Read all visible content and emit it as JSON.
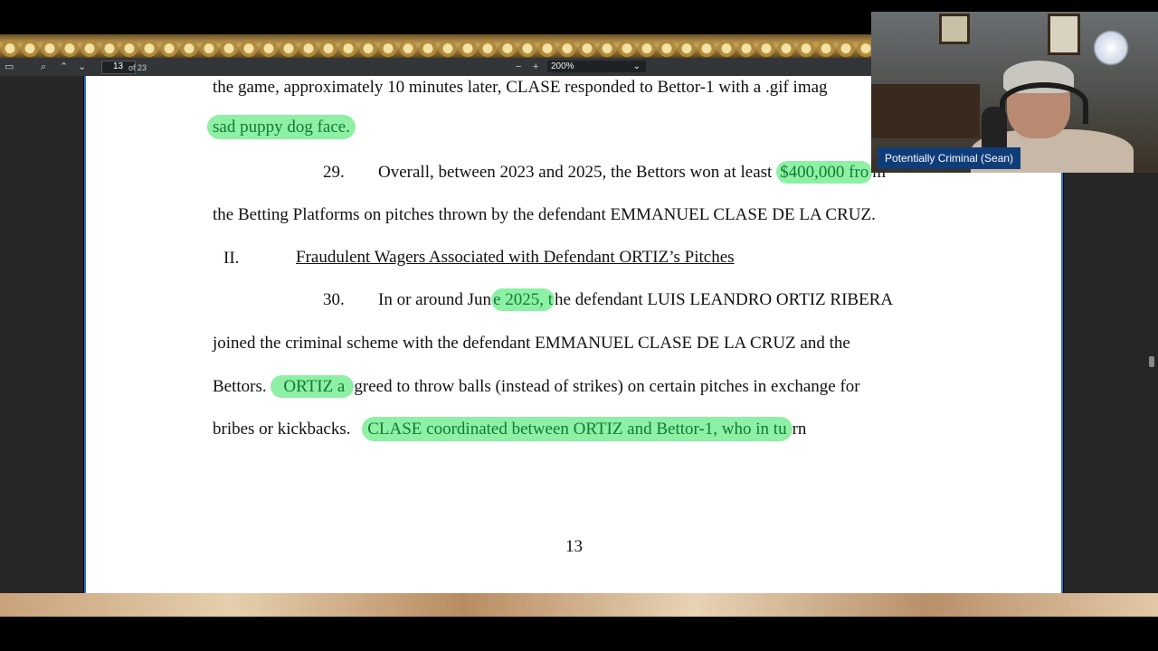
{
  "toolbar": {
    "page_current": "13",
    "page_total": "of 23",
    "zoom": "200%"
  },
  "document": {
    "l1": "the game, approximately 10 minutes later, CLASE responded to Bettor-1 with a .gif imag",
    "l2_hl": "sad puppy dog face.",
    "l3_num": "29.",
    "l3_text": "Overall, between 2023 and 2025, the Bettors won at least ",
    "l3_hl": "$400,000 fro",
    "l3_tail": "m",
    "l4": "the Betting Platforms on pitches thrown by the defendant EMMANUEL CLASE DE LA CRUZ.",
    "section_num": "II.",
    "section_title": "Fraudulent Wagers Associated with Defendant ORTIZ’s Pitches",
    "l6_num": "30.",
    "l6_pre": "In or around Jun",
    "l6_hl": "e 2025, t",
    "l6_post": "he defendant LUIS LEANDRO ORTIZ RIBERA",
    "l7": "joined the criminal scheme with the defendant EMMANUEL CLASE DE LA CRUZ and the",
    "l8_pre": "Bettors.",
    "l8_hl": "ORTIZ a",
    "l8_post": "greed to throw balls (instead of strikes) on certain pitches in exchange for",
    "l9_pre": "bribes or kickbacks.",
    "l9_hl": "CLASE coordinated between ORTIZ and Bettor-1, who in tu",
    "l9_post": "rn",
    "page_number": "13"
  },
  "webcam": {
    "caption": "Potentially Criminal (Sean)"
  },
  "colors": {
    "highlight": "#8ef0a4",
    "highlight_text": "#127a36",
    "nameplate": "#0f3d7a"
  }
}
